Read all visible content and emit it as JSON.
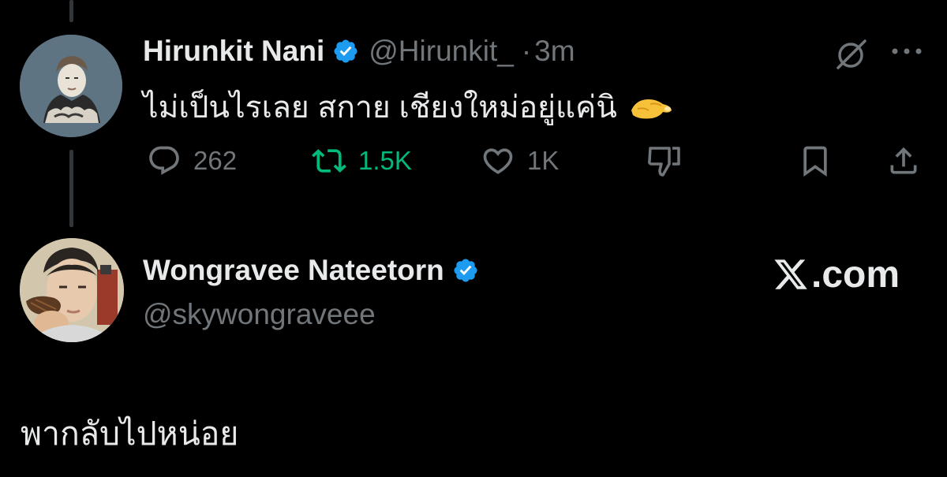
{
  "colors": {
    "background": "#000000",
    "text_primary": "#e7e9ea",
    "text_secondary": "#71767b",
    "verified_blue": "#1d9bf0",
    "repost_green": "#00ba7c",
    "thread_line": "#333639"
  },
  "tweet": {
    "author_name": "Hirunkit Nani",
    "author_handle": "@Hirunkit_",
    "separator": "·",
    "time": "3m",
    "verified_icon": "verified-badge-icon",
    "text": "ไม่เป็นไรเลย สกาย เชียงใหม่อยู่แค่นิ",
    "emoji": "pinching-hand-emoji",
    "header_icons": [
      "grok-icon",
      "more-icon"
    ],
    "actions": {
      "reply": {
        "icon": "reply-icon",
        "count": "262"
      },
      "repost": {
        "icon": "repost-icon",
        "count": "1.5K",
        "active": true
      },
      "like": {
        "icon": "heart-icon",
        "count": "1K"
      },
      "dislike": {
        "icon": "dislike-icon"
      },
      "bookmark": {
        "icon": "bookmark-icon"
      },
      "share": {
        "icon": "share-icon"
      }
    }
  },
  "quoted": {
    "author_name": "Wongravee Nateetorn",
    "author_handle": "@skywongraveee",
    "verified_icon": "verified-badge-icon",
    "brand_suffix": ".com",
    "brand_icon": "x-logo-icon",
    "text": "พากลับไปหน่อย"
  }
}
